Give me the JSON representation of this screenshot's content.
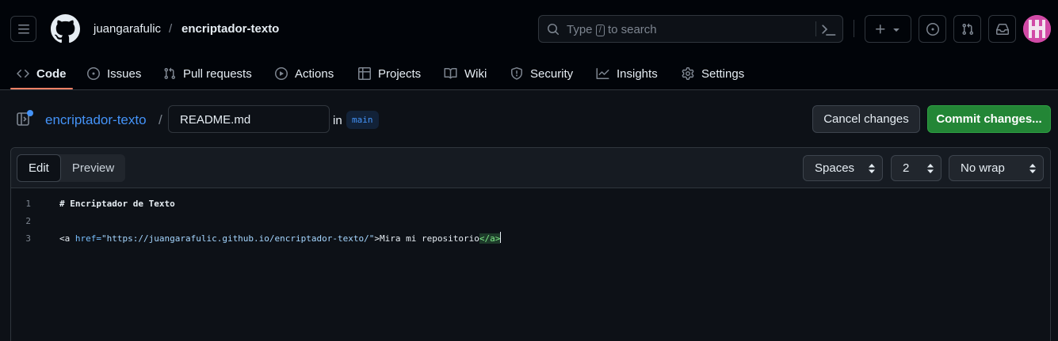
{
  "header": {
    "owner": "juangarafulic",
    "separator": "/",
    "repo": "encriptador-texto",
    "search": {
      "prefix": "Type",
      "key": "/",
      "suffix": "to search"
    }
  },
  "nav": {
    "tabs": [
      {
        "label": "Code",
        "icon": "code-icon",
        "active": true
      },
      {
        "label": "Issues",
        "icon": "issue-opened-icon"
      },
      {
        "label": "Pull requests",
        "icon": "git-pull-request-icon"
      },
      {
        "label": "Actions",
        "icon": "play-icon"
      },
      {
        "label": "Projects",
        "icon": "table-icon"
      },
      {
        "label": "Wiki",
        "icon": "book-icon"
      },
      {
        "label": "Security",
        "icon": "shield-icon"
      },
      {
        "label": "Insights",
        "icon": "graph-icon"
      },
      {
        "label": "Settings",
        "icon": "gear-icon"
      }
    ]
  },
  "file": {
    "repo_link": "encriptador-texto",
    "slash": "/",
    "filename": "README.md",
    "in_label": "in",
    "branch": "main",
    "cancel_label": "Cancel changes",
    "commit_label": "Commit changes..."
  },
  "editor": {
    "edit_label": "Edit",
    "preview_label": "Preview",
    "indent_mode": "Spaces",
    "indent_size": "2",
    "wrap_mode": "No wrap",
    "lines": [
      {
        "number": "1",
        "heading": "# Encriptador de Texto"
      },
      {
        "number": "2"
      },
      {
        "number": "3",
        "tag_open": "<a ",
        "attr": "href=",
        "value": "\"https://juangarafulic.github.io/encriptador-texto/\"",
        "tag_end": ">",
        "content": "Mira mi repositorio",
        "close_tag": "</a",
        "close_end": ">"
      }
    ]
  },
  "colors": {
    "accent_link": "#4493f8",
    "commit_green": "#238636",
    "tab_underline": "#f78166"
  }
}
